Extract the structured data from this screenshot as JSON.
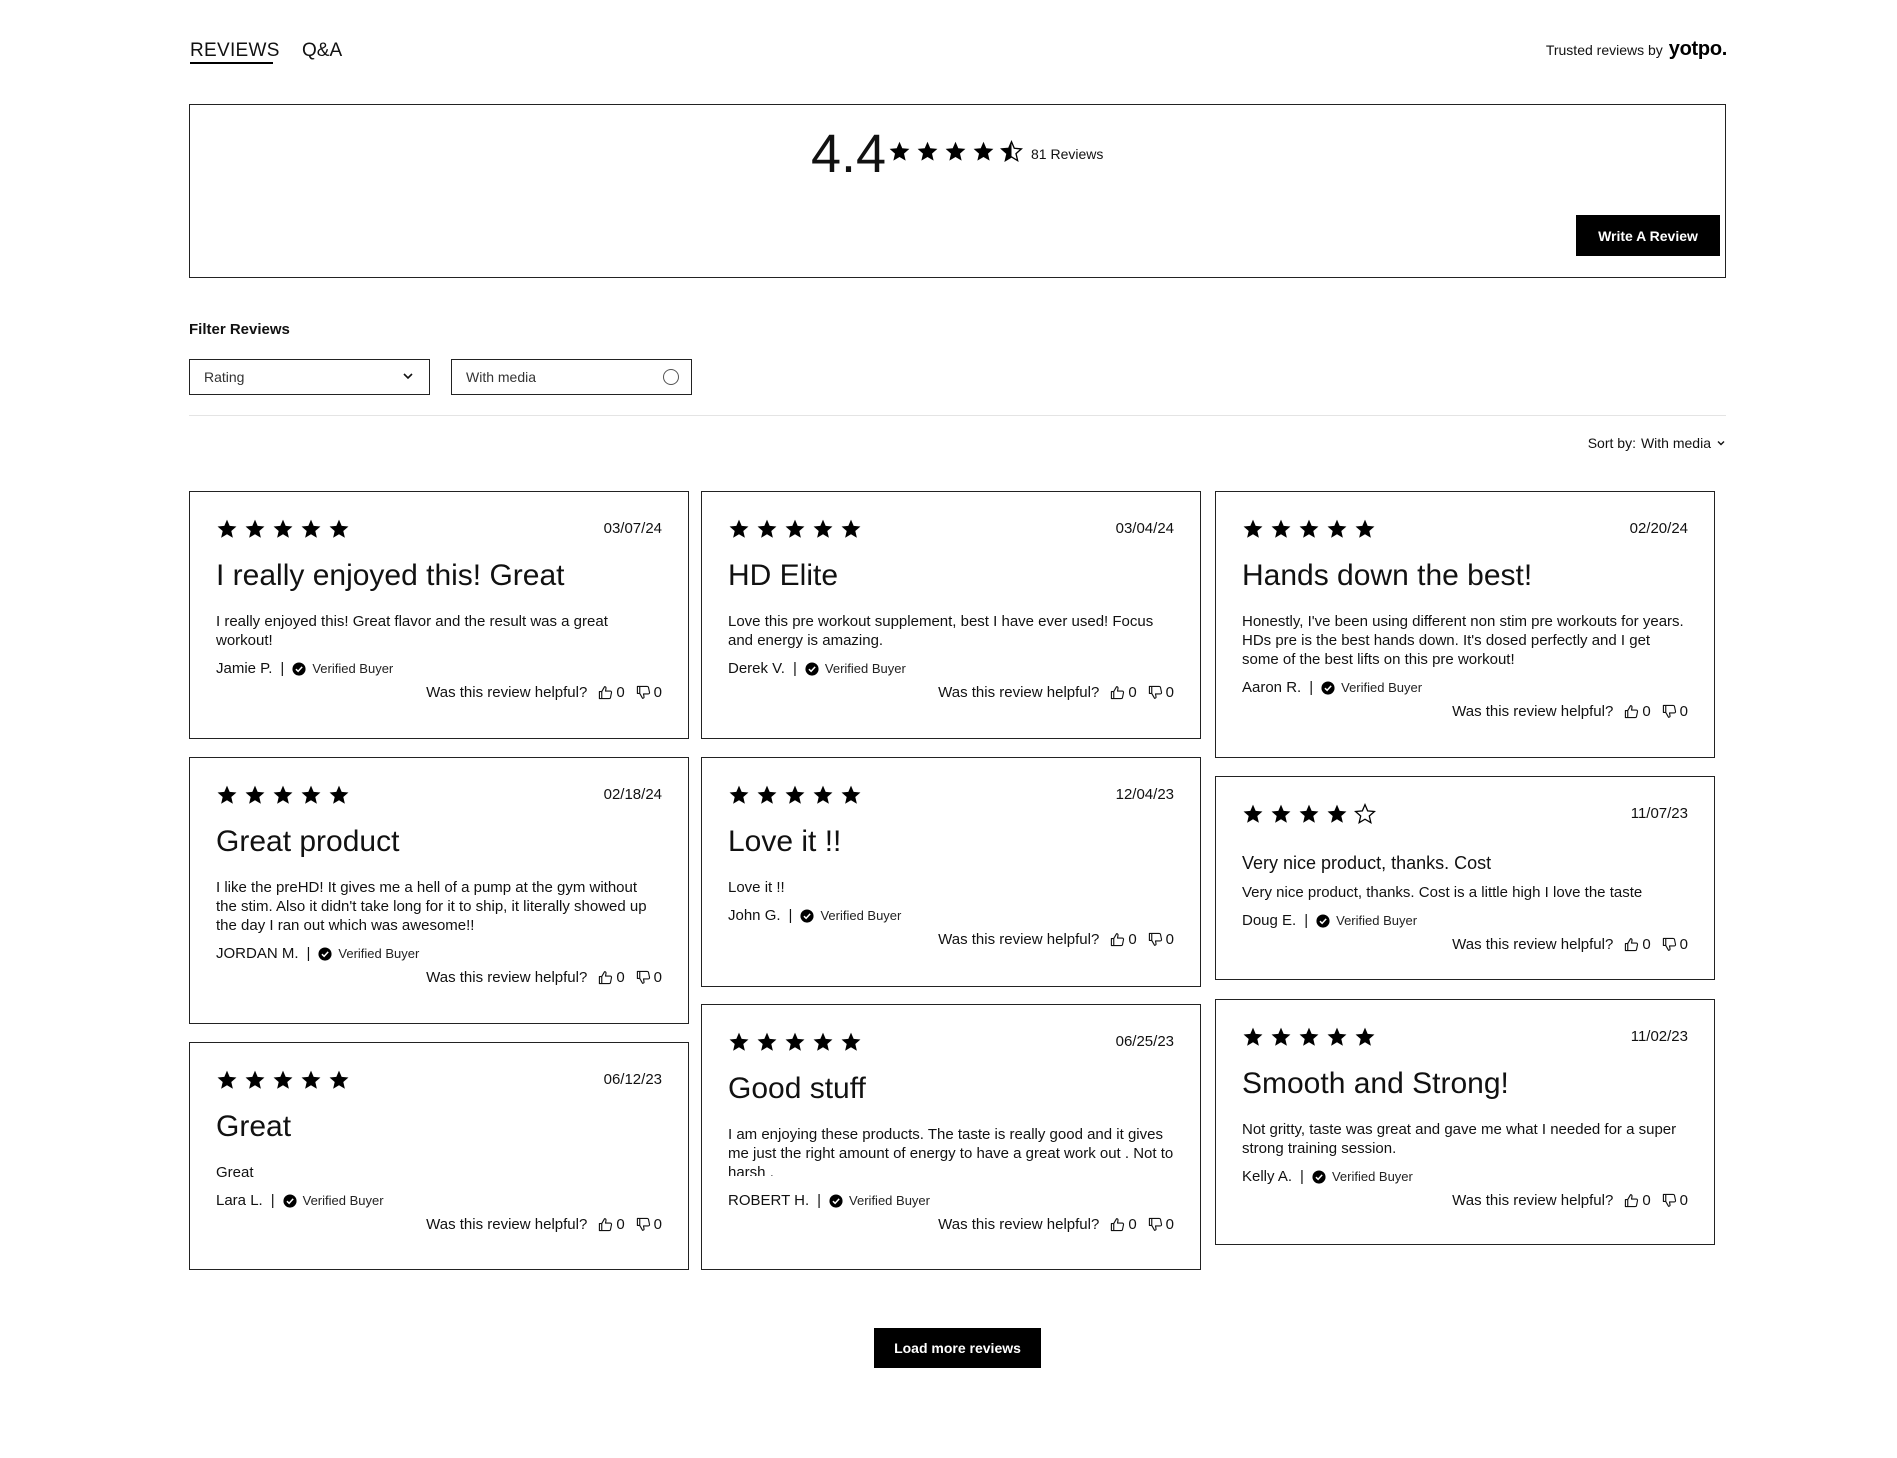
{
  "tabs": [
    {
      "label": "REVIEWS"
    },
    {
      "label": "Q&A"
    }
  ],
  "trusted": {
    "prefix": "Trusted reviews by",
    "logo": "yotpo."
  },
  "summary": {
    "average": "4.4",
    "rating_value": 4.4,
    "count_label": "81 Reviews",
    "write_button": "Write A Review"
  },
  "filter": {
    "title": "Filter Reviews",
    "rating_label": "Rating",
    "media_label": "With media"
  },
  "sort": {
    "label": "Sort by:",
    "value": "With media"
  },
  "helpful_label": "Was this review helpful?",
  "verified_label": "Verified Buyer",
  "reviews": [
    {
      "rating": 5,
      "date": "03/07/24",
      "title": "I really enjoyed this! Great",
      "body": "I really enjoyed this! Great flavor and the result was a great workout!",
      "author": "Jamie P.",
      "up": "0",
      "down": "0"
    },
    {
      "rating": 5,
      "date": "03/04/24",
      "title": "HD Elite",
      "body": "Love this pre workout supplement, best I have ever used! Focus and energy is amazing.",
      "author": "Derek V.",
      "up": "0",
      "down": "0"
    },
    {
      "rating": 5,
      "date": "02/20/24",
      "title": "Hands down the best!",
      "body": "Honestly, I've been using different non stim pre workouts for years. HDs pre is the best hands down. It's dosed perfectly and I get some of the best lifts on this pre workout!",
      "author": "Aaron R.",
      "up": "0",
      "down": "0"
    },
    {
      "rating": 5,
      "date": "02/18/24",
      "title": "Great product",
      "body": "I like the preHD! It gives me a hell of a pump at the gym without the stim. Also it didn't take long for it to ship, it literally showed up the day I ran out which was awesome!!",
      "author": "JORDAN M.",
      "up": "0",
      "down": "0"
    },
    {
      "rating": 5,
      "date": "12/04/23",
      "title": "Love it !!",
      "body": "Love it !!",
      "author": "John G.",
      "up": "0",
      "down": "0"
    },
    {
      "rating": 4,
      "date": "11/07/23",
      "title": "Very nice product, thanks. Cost",
      "body": "Very nice product, thanks. Cost is a little high I love the taste",
      "author": "Doug E.",
      "up": "0",
      "down": "0"
    },
    {
      "rating": 5,
      "date": "06/12/23",
      "title": "Great",
      "body": "Great",
      "author": "Lara L.",
      "up": "0",
      "down": "0"
    },
    {
      "rating": 5,
      "date": "06/25/23",
      "title": "Good stuff",
      "body": "I am enjoying these products. The taste is really good and it gives me just the right amount of energy to have a great work out . Not to harsh .",
      "author": "ROBERT H.",
      "up": "0",
      "down": "0"
    },
    {
      "rating": 5,
      "date": "11/02/23",
      "title": "Smooth and Strong!",
      "body": "Not gritty, taste was great and gave me what I needed for a super strong training session.",
      "author": "Kelly A.",
      "up": "0",
      "down": "0"
    }
  ],
  "load_more": "Load more reviews"
}
